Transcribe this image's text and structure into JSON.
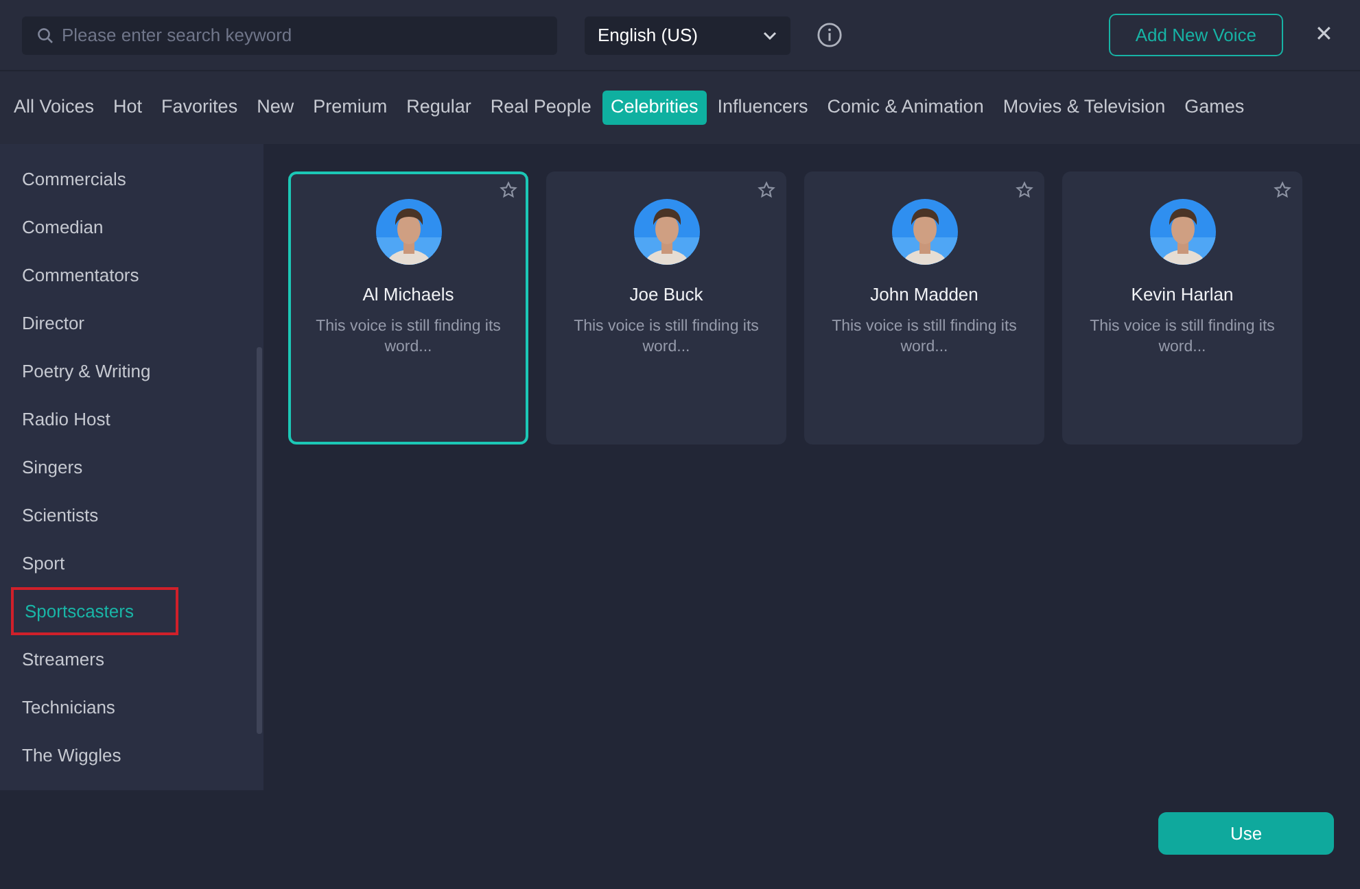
{
  "search": {
    "placeholder": "Please enter search keyword"
  },
  "language": {
    "value": "English (US)"
  },
  "add_button": "Add New Voice",
  "close": "✕",
  "tabs": [
    {
      "label": "All Voices",
      "selected": false
    },
    {
      "label": "Hot",
      "selected": false
    },
    {
      "label": "Favorites",
      "selected": false
    },
    {
      "label": "New",
      "selected": false
    },
    {
      "label": "Premium",
      "selected": false
    },
    {
      "label": "Regular",
      "selected": false
    },
    {
      "label": "Real People",
      "selected": false
    },
    {
      "label": "Celebrities",
      "selected": true
    },
    {
      "label": "Influencers",
      "selected": false
    },
    {
      "label": "Comic & Animation",
      "selected": false
    },
    {
      "label": "Movies & Television",
      "selected": false
    },
    {
      "label": "Games",
      "selected": false
    }
  ],
  "sidebar": {
    "items": [
      {
        "label": "Commercials",
        "selected": false,
        "outlined": false
      },
      {
        "label": "Comedian",
        "selected": false,
        "outlined": false
      },
      {
        "label": "Commentators",
        "selected": false,
        "outlined": false
      },
      {
        "label": "Director",
        "selected": false,
        "outlined": false
      },
      {
        "label": "Poetry & Writing",
        "selected": false,
        "outlined": false
      },
      {
        "label": "Radio Host",
        "selected": false,
        "outlined": false
      },
      {
        "label": "Singers",
        "selected": false,
        "outlined": false
      },
      {
        "label": "Scientists",
        "selected": false,
        "outlined": false
      },
      {
        "label": "Sport",
        "selected": false,
        "outlined": false
      },
      {
        "label": "Sportscasters",
        "selected": true,
        "outlined": true
      },
      {
        "label": "Streamers",
        "selected": false,
        "outlined": false
      },
      {
        "label": "Technicians",
        "selected": false,
        "outlined": false
      },
      {
        "label": "The Wiggles",
        "selected": false,
        "outlined": false
      }
    ]
  },
  "voices": [
    {
      "name": "Al Michaels",
      "description": "This voice is still finding its word...",
      "selected": true,
      "favorite": false
    },
    {
      "name": "Joe Buck",
      "description": "This voice is still finding its word...",
      "selected": false,
      "favorite": false
    },
    {
      "name": "John Madden",
      "description": "This voice is still finding its word...",
      "selected": false,
      "favorite": false
    },
    {
      "name": "Kevin Harlan",
      "description": "This voice is still finding its word...",
      "selected": false,
      "favorite": false
    }
  ],
  "use_button": "Use"
}
